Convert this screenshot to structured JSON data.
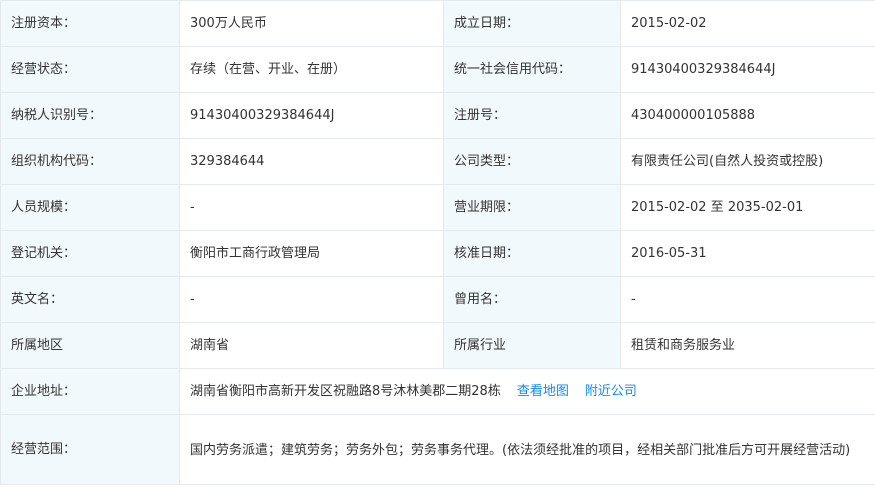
{
  "rows": [
    {
      "l1": "注册资本：",
      "v1": "300万人民币",
      "l2": "成立日期：",
      "v2": "2015-02-02"
    },
    {
      "l1": "经营状态：",
      "v1": "存续（在营、开业、在册）",
      "l2": "统一社会信用代码：",
      "v2": "91430400329384644J"
    },
    {
      "l1": "纳税人识别号：",
      "v1": "91430400329384644J",
      "l2": "注册号：",
      "v2": "430400000105888"
    },
    {
      "l1": "组织机构代码：",
      "v1": "329384644",
      "l2": "公司类型：",
      "v2": "有限责任公司(自然人投资或控股)"
    },
    {
      "l1": "人员规模：",
      "v1": "-",
      "l2": "营业期限：",
      "v2": "2015-02-02 至 2035-02-01"
    },
    {
      "l1": "登记机关：",
      "v1": "衡阳市工商行政管理局",
      "l2": "核准日期：",
      "v2": "2016-05-31"
    },
    {
      "l1": "英文名：",
      "v1": "-",
      "l2": "曾用名：",
      "v2": "-"
    },
    {
      "l1": "所属地区",
      "v1": "湖南省",
      "l2": "所属行业",
      "v2": "租赁和商务服务业"
    }
  ],
  "address": {
    "label": "企业地址：",
    "value": "湖南省衡阳市高新开发区祝融路8号沐林美郡二期28栋",
    "map_link": "查看地图",
    "nearby_link": "附近公司"
  },
  "scope": {
    "label": "经营范围：",
    "value": "国内劳务派遣；建筑劳务；劳务外包；劳务事务代理。(依法须经批准的项目，经相关部门批准后方可开展经营活动)"
  },
  "colors": {
    "label_bg": "#f2f9fc",
    "border": "#e4eaec",
    "link": "#128bed"
  }
}
